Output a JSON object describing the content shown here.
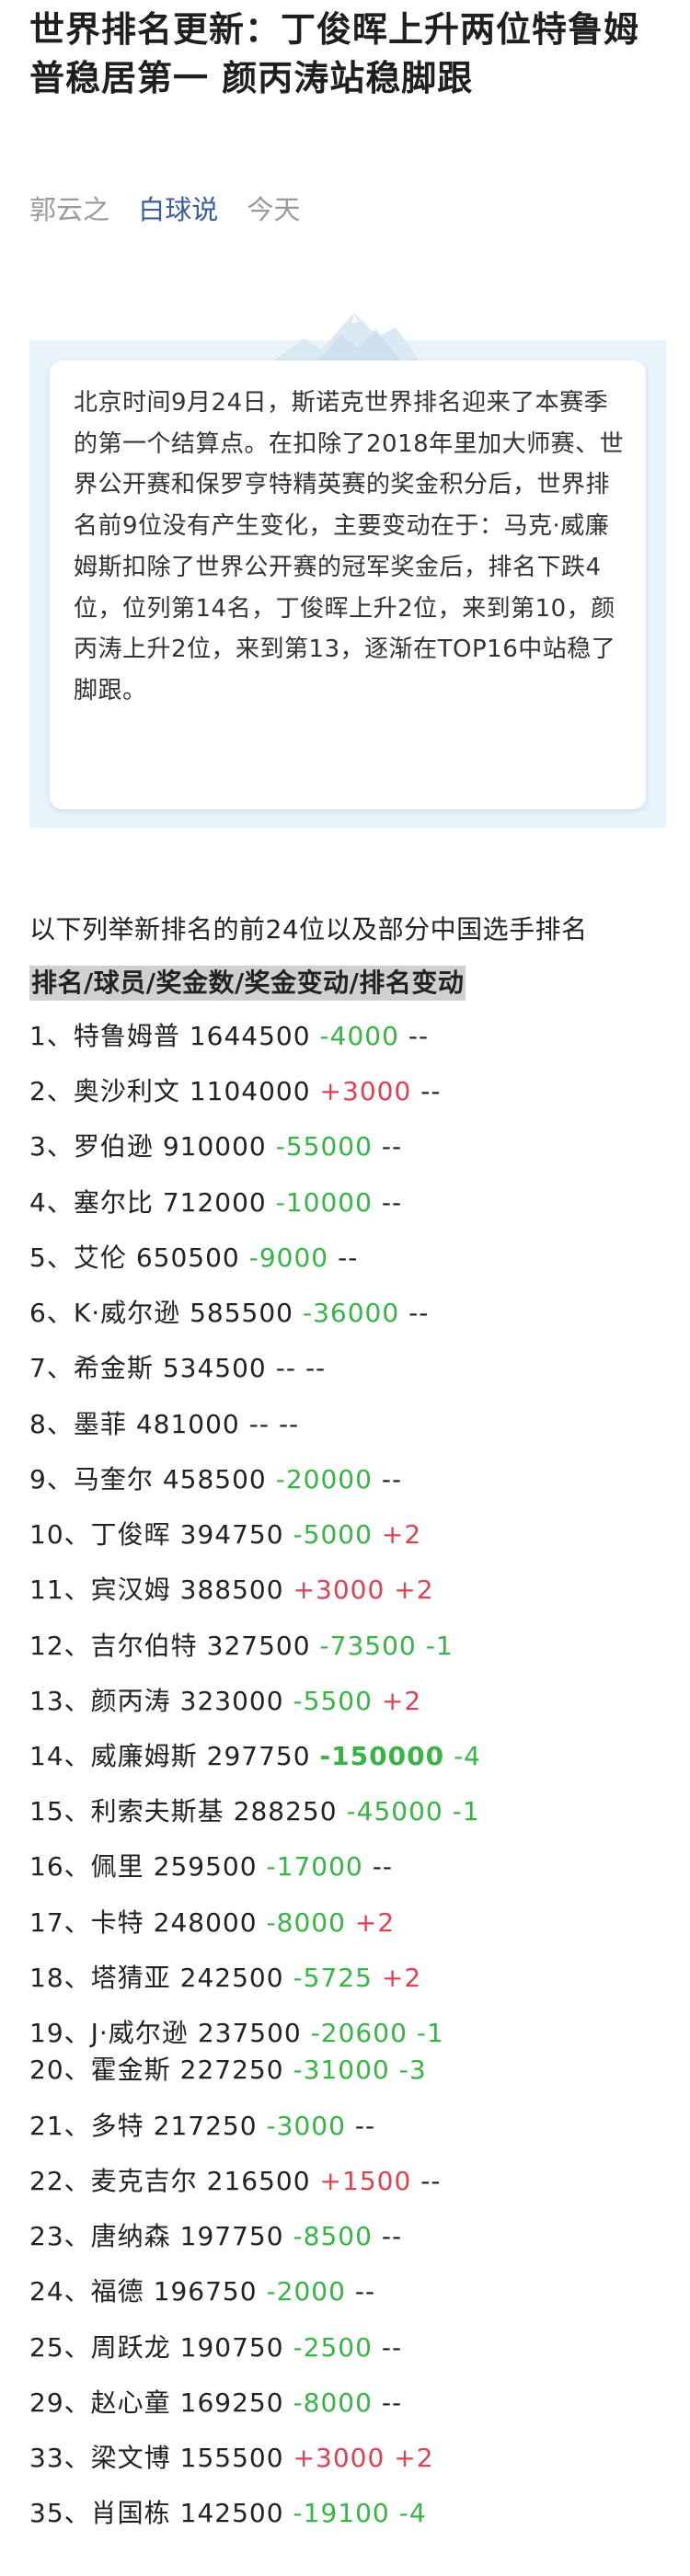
{
  "article": {
    "title": "世界排名更新：丁俊晖上升两位特鲁姆普稳居第一 颜丙涛站稳脚跟",
    "author": "郭云之",
    "channel": "白球说",
    "date": "今天"
  },
  "summary": {
    "text": "北京时间9月24日，斯诺克世界排名迎来了本赛季的第一个结算点。在扣除了2018年里加大师赛、世界公开赛和保罗亨特精英赛的奖金积分后，世界排名前9位没有产生变化，主要变动在于：马克·威廉姆斯扣除了世界公开赛的冠军奖金后，排名下跌4位，位列第14名，丁俊晖上升2位，来到第10，颜丙涛上升2位，来到第13，逐渐在TOP16中站稳了脚跟。"
  },
  "ranking": {
    "intro": "以下列举新排名的前24位以及部分中国选手排名",
    "header": "排名/球员/奖金数/奖金变动/排名变动",
    "rows": [
      {
        "rank": "1、",
        "player": "特鲁姆普",
        "prize": "1644500",
        "prize_change": "-4000",
        "rank_change": "--"
      },
      {
        "rank": "2、",
        "player": "奥沙利文",
        "prize": "1104000",
        "prize_change": "+3000",
        "rank_change": "--"
      },
      {
        "rank": "3、",
        "player": "罗伯逊",
        "prize": "910000",
        "prize_change": "-55000",
        "rank_change": "--"
      },
      {
        "rank": "4、",
        "player": "塞尔比",
        "prize": "712000",
        "prize_change": "-10000",
        "rank_change": "--"
      },
      {
        "rank": "5、",
        "player": "艾伦",
        "prize": "650500",
        "prize_change": "-9000",
        "rank_change": "--"
      },
      {
        "rank": "6、",
        "player": "K·威尔逊",
        "prize": "585500",
        "prize_change": "-36000",
        "rank_change": "--"
      },
      {
        "rank": "7、",
        "player": "希金斯",
        "prize": "534500",
        "prize_change": "--",
        "rank_change": "--"
      },
      {
        "rank": "8、",
        "player": "墨菲",
        "prize": "481000",
        "prize_change": "--",
        "rank_change": "--"
      },
      {
        "rank": "9、",
        "player": "马奎尔",
        "prize": "458500",
        "prize_change": "-20000",
        "rank_change": "--"
      },
      {
        "rank": "10、",
        "player": "丁俊晖",
        "prize": "394750",
        "prize_change": "-5000",
        "rank_change": "+2"
      },
      {
        "rank": "11、",
        "player": "宾汉姆",
        "prize": "388500",
        "prize_change": "+3000",
        "rank_change": "+2"
      },
      {
        "rank": "12、",
        "player": "吉尔伯特",
        "prize": "327500",
        "prize_change": "-73500",
        "rank_change": "-1"
      },
      {
        "rank": "13、",
        "player": "颜丙涛",
        "prize": "323000",
        "prize_change": "-5500",
        "rank_change": "+2"
      },
      {
        "rank": "14、",
        "player": "威廉姆斯",
        "prize": "297750",
        "prize_change": "-150000",
        "rank_change": "-4"
      },
      {
        "rank": "15、",
        "player": "利索夫斯基",
        "prize": "288250",
        "prize_change": "-45000",
        "rank_change": "-1"
      },
      {
        "rank": "16、",
        "player": "佩里",
        "prize": "259500",
        "prize_change": "-17000",
        "rank_change": "--"
      },
      {
        "rank": "17、",
        "player": "卡特",
        "prize": "248000",
        "prize_change": "-8000",
        "rank_change": "+2"
      },
      {
        "rank": "18、",
        "player": "塔猜亚",
        "prize": "242500",
        "prize_change": "-5725",
        "rank_change": "+2"
      },
      {
        "rank": "19、",
        "player": "J·威尔逊",
        "prize": "237500",
        "prize_change": "-20600",
        "rank_change": "-1"
      },
      {
        "rank": "20、",
        "player": "霍金斯",
        "prize": "227250",
        "prize_change": "-31000",
        "rank_change": "-3"
      },
      {
        "rank": "21、",
        "player": "多特",
        "prize": "217250",
        "prize_change": "-3000",
        "rank_change": "--"
      },
      {
        "rank": "22、",
        "player": "麦克吉尔",
        "prize": "216500",
        "prize_change": "+1500",
        "rank_change": "--"
      },
      {
        "rank": "23、",
        "player": "唐纳森",
        "prize": "197750",
        "prize_change": "-8500",
        "rank_change": "--"
      },
      {
        "rank": "24、",
        "player": "福德",
        "prize": "196750",
        "prize_change": "-2000",
        "rank_change": "--"
      },
      {
        "rank": "25、",
        "player": "周跃龙",
        "prize": "190750",
        "prize_change": "-2500",
        "rank_change": "--"
      },
      {
        "rank": "29、",
        "player": "赵心童",
        "prize": "169250",
        "prize_change": "-8000",
        "rank_change": "--"
      },
      {
        "rank": "33、",
        "player": "梁文博",
        "prize": "155500",
        "prize_change": "+3000",
        "rank_change": "+2"
      },
      {
        "rank": "35、",
        "player": "肖国栋",
        "prize": "142500",
        "prize_change": "-19100",
        "rank_change": "-4"
      }
    ]
  },
  "colors": {
    "negative": "#36b544",
    "positive": "#e0404f",
    "channel": "#3b5f9a"
  }
}
